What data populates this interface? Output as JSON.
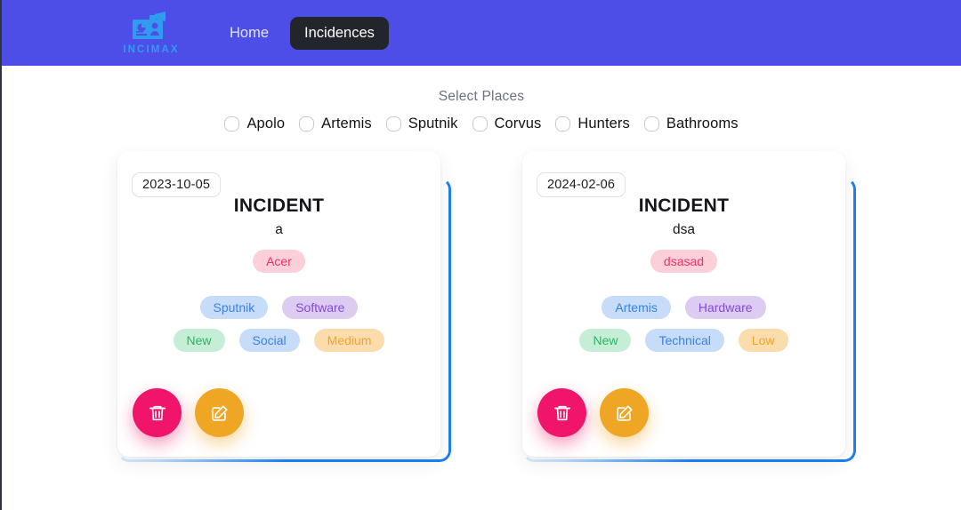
{
  "app": {
    "brand_name": "INCIMAX",
    "brand_icon": "dashboard-megaphone-icon"
  },
  "nav": {
    "links": [
      {
        "label": "Home",
        "active": false
      },
      {
        "label": "Incidences",
        "active": true
      }
    ]
  },
  "filters": {
    "title": "Select Places",
    "places": [
      {
        "label": "Apolo",
        "checked": false
      },
      {
        "label": "Artemis",
        "checked": false
      },
      {
        "label": "Sputnik",
        "checked": false
      },
      {
        "label": "Corvus",
        "checked": false
      },
      {
        "label": "Hunters",
        "checked": false
      },
      {
        "label": "Bathrooms",
        "checked": false
      }
    ]
  },
  "cards": [
    {
      "date": "2023-10-05",
      "title": "INCIDENT",
      "subtitle": "a",
      "main_tag": {
        "label": "Acer",
        "color": "pink"
      },
      "tags": [
        {
          "label": "Sputnik",
          "color": "blue"
        },
        {
          "label": "Software",
          "color": "purple"
        },
        {
          "label": "New",
          "color": "green"
        },
        {
          "label": "Social",
          "color": "blue"
        },
        {
          "label": "Medium",
          "color": "orange"
        }
      ],
      "delete_label": "Delete",
      "edit_label": "Edit"
    },
    {
      "date": "2024-02-06",
      "title": "INCIDENT",
      "subtitle": "dsa",
      "main_tag": {
        "label": "dsasad",
        "color": "pink"
      },
      "tags": [
        {
          "label": "Artemis",
          "color": "blue"
        },
        {
          "label": "Hardware",
          "color": "purple"
        },
        {
          "label": "New",
          "color": "green"
        },
        {
          "label": "Technical",
          "color": "blue"
        },
        {
          "label": "Low",
          "color": "orange"
        }
      ],
      "delete_label": "Delete",
      "edit_label": "Edit"
    }
  ],
  "colors": {
    "header_bg": "#4d4ee8",
    "active_tab_bg": "#23252c",
    "brand_blue": "#2e9df0",
    "accent_border": "#1a7ef0",
    "delete_bg": "#f0156a",
    "edit_bg": "#f0a625"
  }
}
